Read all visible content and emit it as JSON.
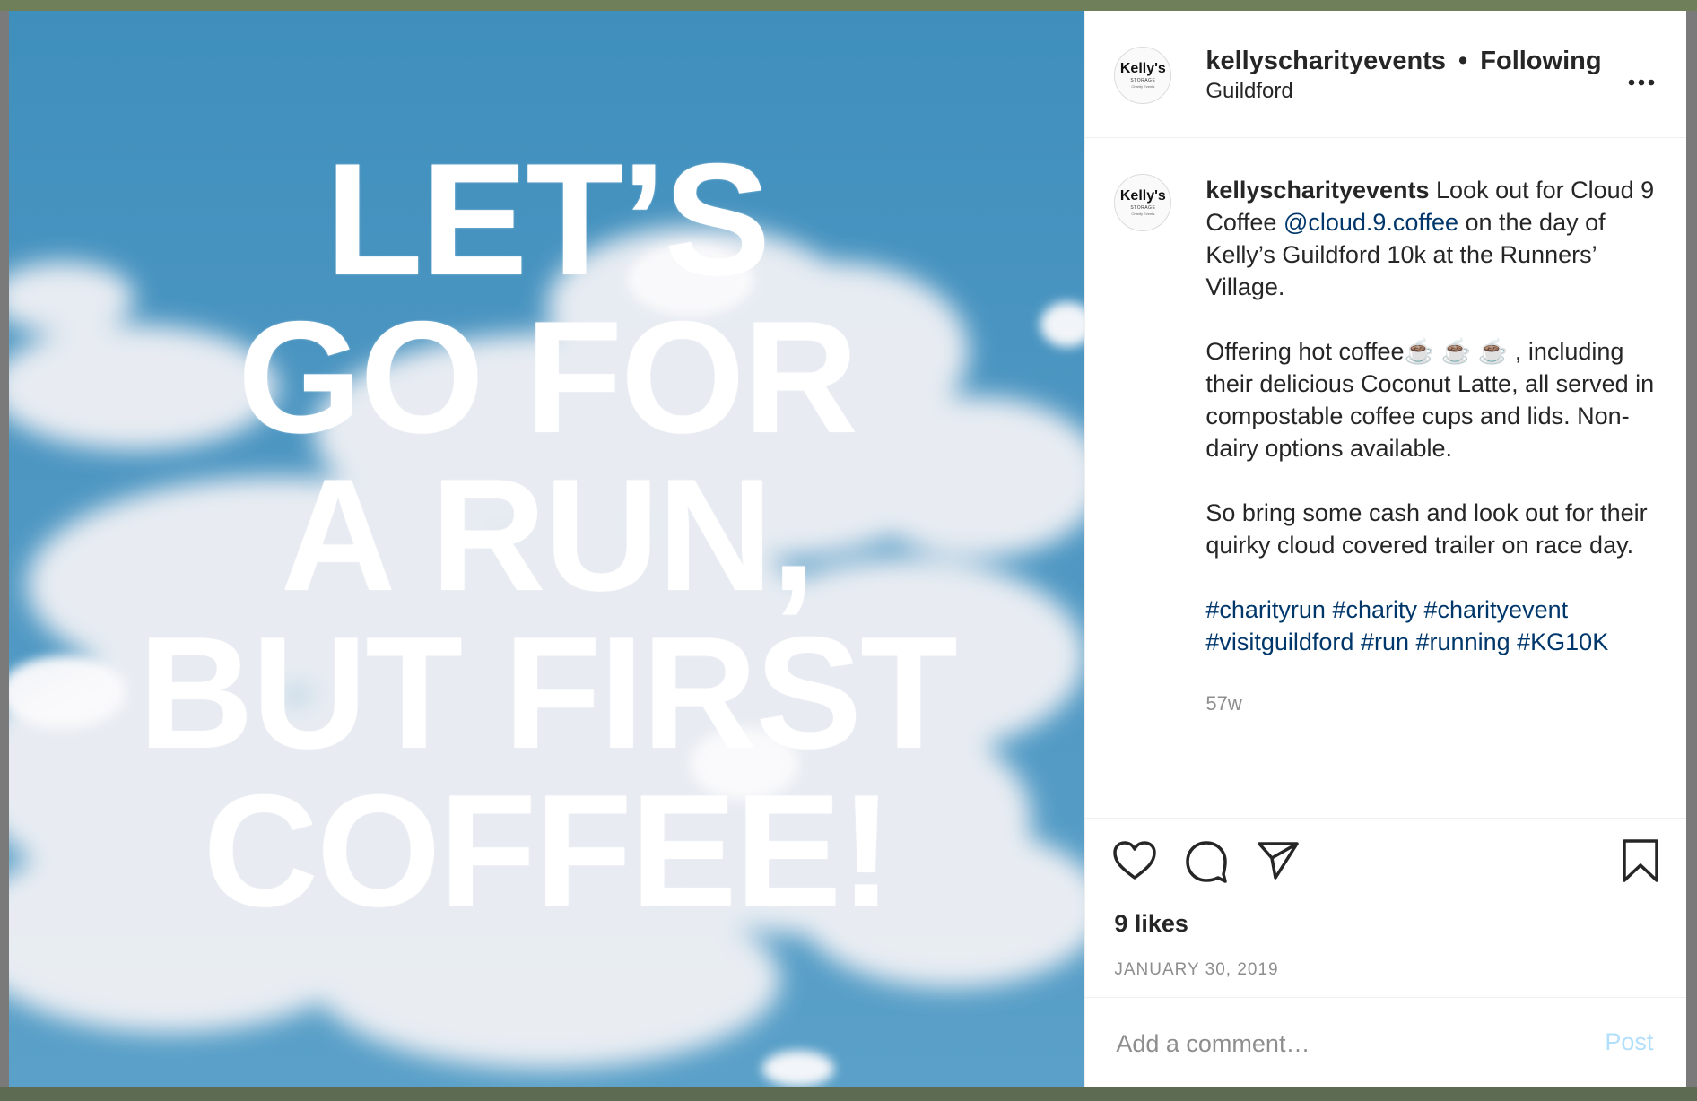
{
  "post": {
    "image": {
      "headline_lines": [
        "LET’S",
        "GO FOR",
        "A RUN,",
        "BUT FIRST",
        "COFFEE!"
      ]
    },
    "header": {
      "avatar_text": "Kelly's",
      "avatar_sub": "STORAGE",
      "avatar_sub2": "Charity Events",
      "username": "kellyscharityevents",
      "separator": "•",
      "follow_status": "Following",
      "location": "Guildford",
      "more_icon": "more-horizontal-icon"
    },
    "caption": {
      "username": "kellyscharityevents",
      "text_1": " Look out for Cloud 9 Coffee ",
      "mention": "@cloud.9.coffee",
      "text_2": " on the day of Kelly’s Guildford 10k at the Runners’ Village.",
      "paragraph_2": "Offering hot coffee☕ ☕ ☕ , including their delicious Coconut Latte, all served in compostable coffee cups and lids. Non-dairy options available.",
      "paragraph_3": "So bring some cash and look out for their quirky cloud covered trailer on race day.",
      "hashtags": [
        "#charityrun",
        "#charity",
        "#charityevent",
        "#visitguildford",
        "#run",
        "#running",
        "#KG10K"
      ],
      "age": "57w"
    },
    "actions": {
      "icons": [
        "heart-icon",
        "comment-icon",
        "share-icon",
        "bookmark-icon"
      ],
      "likes": "9 likes",
      "date": "JANUARY 30, 2019"
    },
    "comment": {
      "placeholder": "Add a comment…",
      "post_label": "Post"
    }
  },
  "colors": {
    "text": "#262626",
    "secondary": "#8e8e8e",
    "link": "#00376b",
    "post_disabled": "#b2dffc",
    "sky": "#4d96c2"
  }
}
